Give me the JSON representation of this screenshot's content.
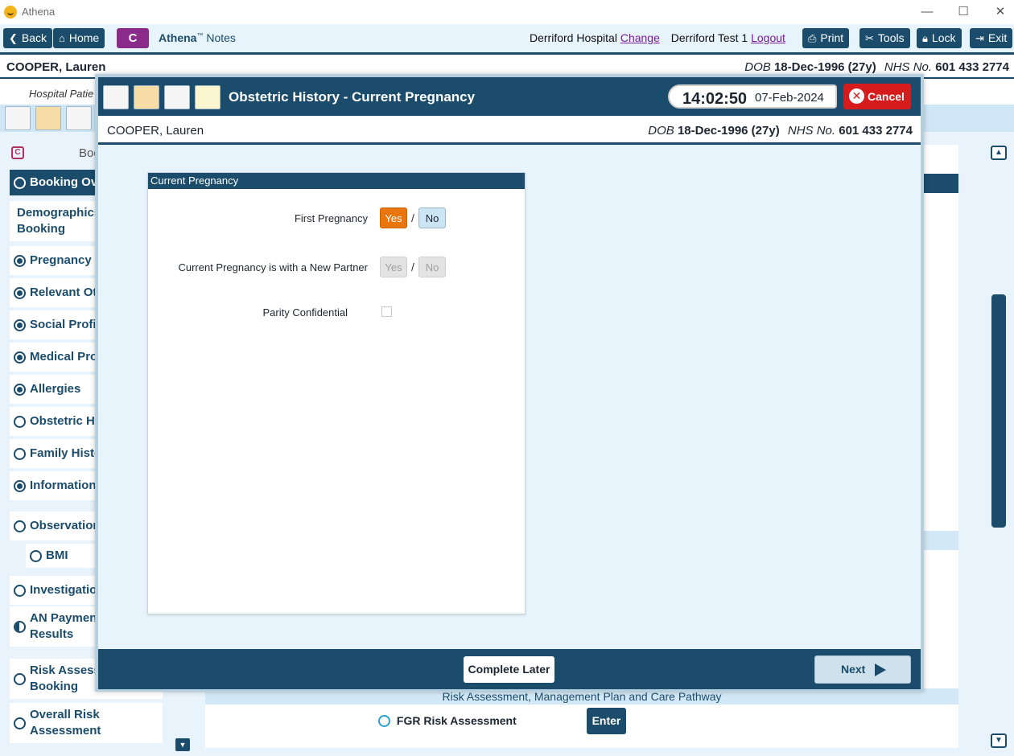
{
  "window": {
    "title": "Athena",
    "controls": {
      "minimize": "—",
      "maximize": "☐",
      "close": "✕"
    }
  },
  "toolbar": {
    "back": "Back",
    "home": "Home",
    "brand_letter": "C",
    "brand_name": "Athena",
    "brand_tm": "™",
    "brand_suffix": " Notes",
    "hospital": "Derriford Hospital",
    "change": "Change",
    "user": "Derriford Test 1",
    "logout": "Logout",
    "print": "Print",
    "tools": "Tools",
    "lock": "Lock",
    "exit": "Exit"
  },
  "patient": {
    "name": "COOPER, Lauren",
    "dob_label": "DOB",
    "dob": "18-Dec-1996 (27y)",
    "nhs_label": "NHS No.",
    "nhs": "601 433 2774"
  },
  "background": {
    "subtitle": "Hospital Patie",
    "section_header_partial": "Boo",
    "risk_bar": "Risk Assessment, Management Plan and Care Pathway",
    "fgr": "FGR Risk Assessment",
    "enter": "Enter",
    "sidebar": [
      {
        "label": "Booking Ove",
        "state": "empty",
        "active": true
      },
      {
        "label": "Demographics\nBooking",
        "state": "none"
      },
      {
        "label": "Pregnancy P",
        "state": "filled"
      },
      {
        "label": "Relevant Oth",
        "state": "filled"
      },
      {
        "label": "Social Profil",
        "state": "filled"
      },
      {
        "label": "Medical Pro",
        "state": "filled"
      },
      {
        "label": "Allergies",
        "state": "filled"
      },
      {
        "label": "Obstetric Hi",
        "state": "empty"
      },
      {
        "label": "Family Histo",
        "state": "empty"
      },
      {
        "label": "Information",
        "state": "filled"
      },
      {
        "label": "Observation",
        "state": "empty"
      },
      {
        "label": "BMI",
        "state": "empty"
      },
      {
        "label": "Investigation",
        "state": "empty"
      },
      {
        "label": "AN Paymen\nResults",
        "state": "half"
      },
      {
        "label": "Risk Assess\nBooking",
        "state": "empty"
      },
      {
        "label": "Overall Risk\nAssessment",
        "state": "empty"
      }
    ]
  },
  "modal": {
    "title": "Obstetric History - Current Pregnancy",
    "time": "14:02:50",
    "date": "07-Feb-2024",
    "cancel": "Cancel",
    "card_title": "Current Pregnancy",
    "fields": {
      "first_pregnancy": {
        "label": "First Pregnancy",
        "yes": "Yes",
        "no": "No",
        "selected": "Yes"
      },
      "new_partner": {
        "label": "Current Pregnancy is with a New Partner",
        "yes": "Yes",
        "no": "No",
        "enabled": false
      },
      "parity_confidential": {
        "label": "Parity Confidential",
        "checked": false
      }
    },
    "complete_later": "Complete Later",
    "next": "Next"
  },
  "colors": {
    "primary": "#1b4c6b",
    "accent_yes": "#e8760d",
    "cancel": "#d51b1b",
    "brand": "#8a2a8a",
    "link": "#7a1a9a"
  }
}
